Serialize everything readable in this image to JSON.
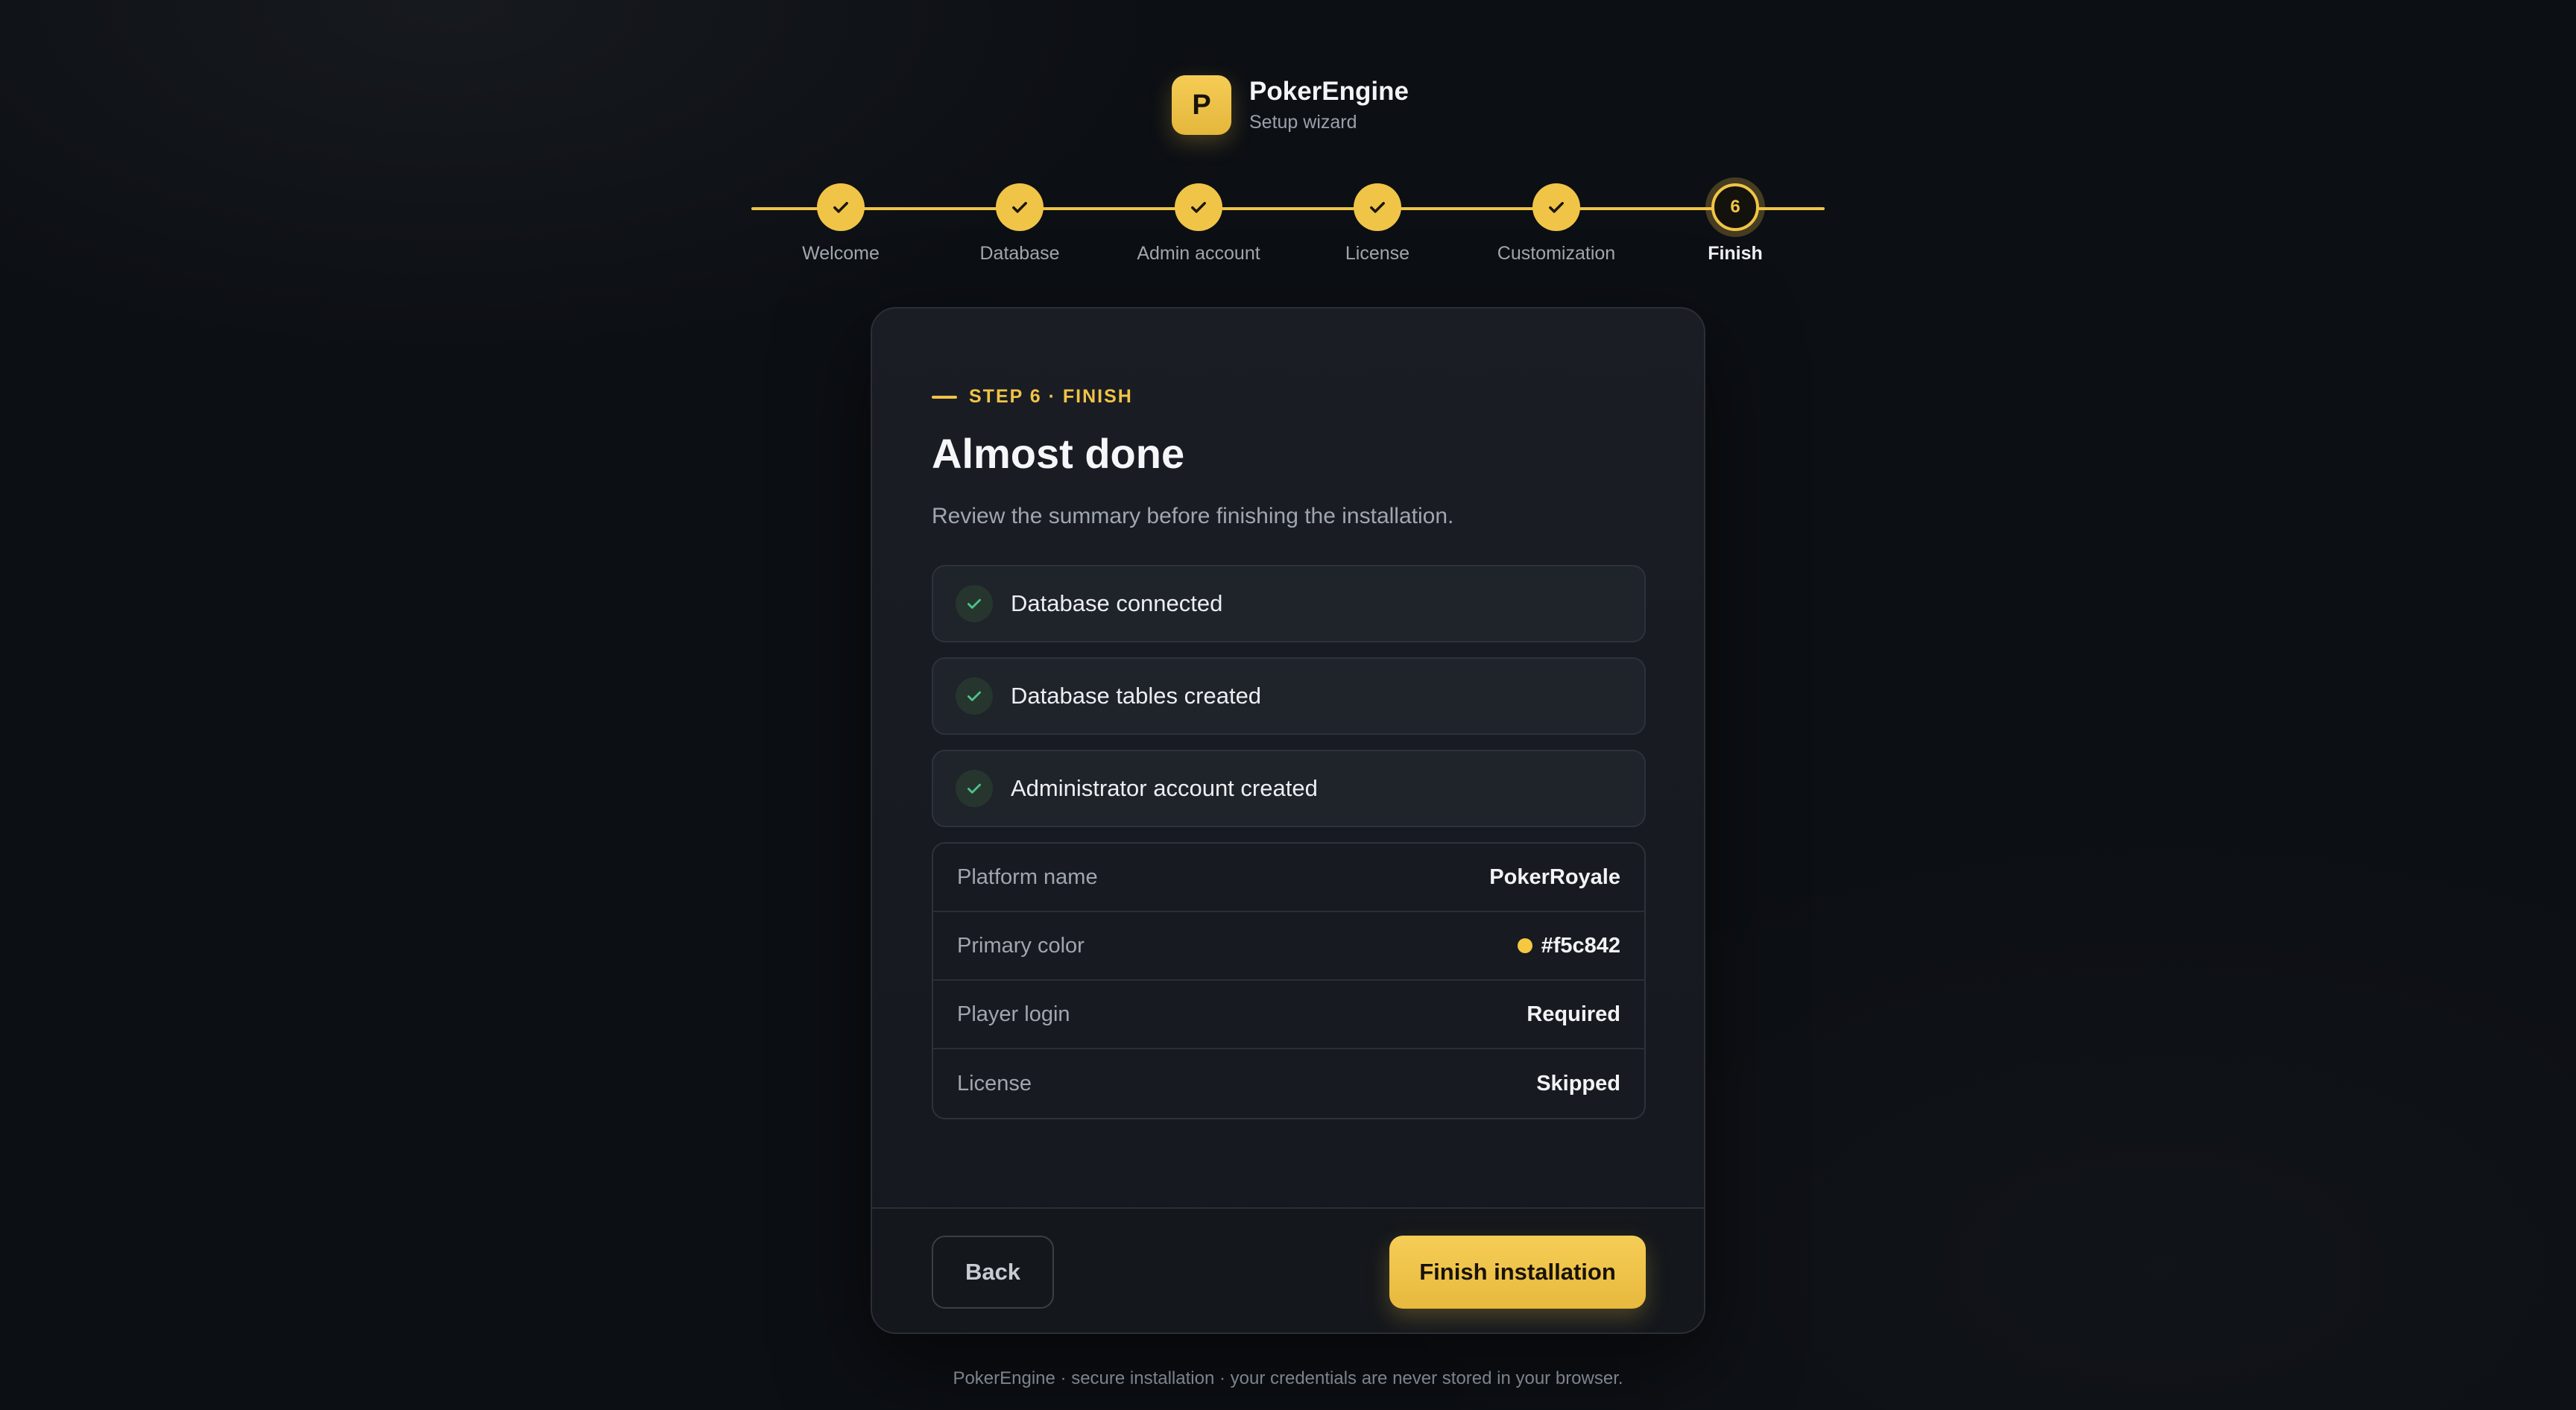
{
  "brand": {
    "logo_letter": "P",
    "name": "PokerEngine",
    "subtitle": "Setup wizard"
  },
  "stepper": {
    "steps": [
      {
        "label": "Welcome",
        "status": "done"
      },
      {
        "label": "Database",
        "status": "done"
      },
      {
        "label": "Admin account",
        "status": "done"
      },
      {
        "label": "License",
        "status": "done"
      },
      {
        "label": "Customization",
        "status": "done"
      },
      {
        "label": "Finish",
        "status": "current",
        "number": "6"
      }
    ]
  },
  "card": {
    "eyebrow": "STEP 6 · FINISH",
    "title": "Almost done",
    "subtitle": "Review the summary before finishing the installation.",
    "checks": [
      {
        "label": "Database connected"
      },
      {
        "label": "Database tables created"
      },
      {
        "label": "Administrator account created"
      }
    ],
    "summary": [
      {
        "key": "Platform name",
        "value": "PokerRoyale"
      },
      {
        "key": "Primary color",
        "value": "#f5c842"
      },
      {
        "key": "Player login",
        "value": "Required"
      },
      {
        "key": "License",
        "value": "Skipped"
      }
    ],
    "back_label": "Back",
    "finish_label": "Finish installation"
  },
  "footer": {
    "text": "PokerEngine · secure installation · your credentials are never stored in your browser."
  },
  "colors": {
    "accent": "#f0c446",
    "primary_swatch": "#f5c842",
    "success": "#4cc38a"
  },
  "icons": {
    "step_done": "check-icon",
    "check_item": "check-circle-icon"
  }
}
